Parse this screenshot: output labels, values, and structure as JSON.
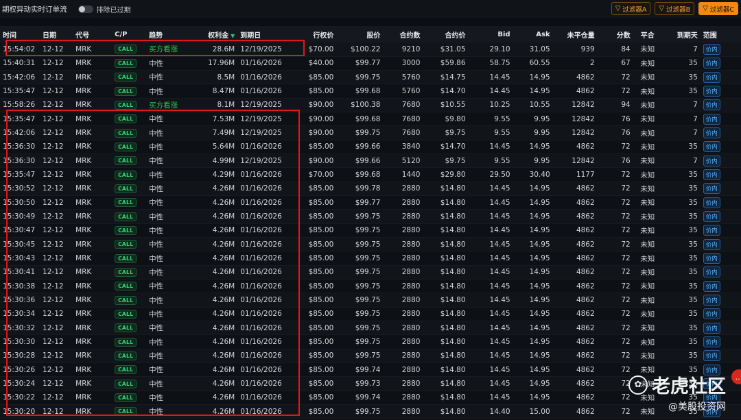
{
  "topbar": {
    "title": "期权异动实时订单流",
    "toggle_label": "排除已过期",
    "filters": [
      "过滤器A",
      "过滤器B",
      "过滤器C"
    ]
  },
  "columns": [
    "时间",
    "日期",
    "代号",
    "C/P",
    "趋势",
    "权利金",
    "到期日",
    "行权价",
    "股价",
    "合约数",
    "合约价",
    "Bid",
    "Ask",
    "未平仓量",
    "分数",
    "平合",
    "到期天",
    "范围"
  ],
  "rows": [
    [
      "15:54:02",
      "12-12",
      "MRK",
      "CALL",
      "买方看涨",
      "28.6M",
      "12/19/2025",
      "$70.00",
      "$100.22",
      "9210",
      "$31.05",
      "29.10",
      "31.05",
      "939",
      "84",
      "未知",
      "7",
      "价内"
    ],
    [
      "15:40:31",
      "12-12",
      "MRK",
      "CALL",
      "中性",
      "17.96M",
      "01/16/2026",
      "$40.00",
      "$99.77",
      "3000",
      "$59.86",
      "58.75",
      "60.55",
      "2",
      "67",
      "未知",
      "35",
      "价内"
    ],
    [
      "15:42:06",
      "12-12",
      "MRK",
      "CALL",
      "中性",
      "8.5M",
      "01/16/2026",
      "$85.00",
      "$99.75",
      "5760",
      "$14.75",
      "14.45",
      "14.95",
      "4862",
      "72",
      "未知",
      "35",
      "价内"
    ],
    [
      "15:35:47",
      "12-12",
      "MRK",
      "CALL",
      "中性",
      "8.47M",
      "01/16/2026",
      "$85.00",
      "$99.68",
      "5760",
      "$14.70",
      "14.45",
      "14.95",
      "4862",
      "72",
      "未知",
      "35",
      "价内"
    ],
    [
      "15:58:26",
      "12-12",
      "MRK",
      "CALL",
      "买方看涨",
      "8.1M",
      "12/19/2025",
      "$90.00",
      "$100.38",
      "7680",
      "$10.55",
      "10.25",
      "10.55",
      "12842",
      "94",
      "未知",
      "7",
      "价内"
    ],
    [
      "15:35:47",
      "12-12",
      "MRK",
      "CALL",
      "中性",
      "7.53M",
      "12/19/2025",
      "$90.00",
      "$99.68",
      "7680",
      "$9.80",
      "9.55",
      "9.95",
      "12842",
      "76",
      "未知",
      "7",
      "价内"
    ],
    [
      "15:42:06",
      "12-12",
      "MRK",
      "CALL",
      "中性",
      "7.49M",
      "12/19/2025",
      "$90.00",
      "$99.75",
      "7680",
      "$9.75",
      "9.55",
      "9.95",
      "12842",
      "76",
      "未知",
      "7",
      "价内"
    ],
    [
      "15:36:30",
      "12-12",
      "MRK",
      "CALL",
      "中性",
      "5.64M",
      "01/16/2026",
      "$85.00",
      "$99.66",
      "3840",
      "$14.70",
      "14.45",
      "14.95",
      "4862",
      "72",
      "未知",
      "35",
      "价内"
    ],
    [
      "15:36:30",
      "12-12",
      "MRK",
      "CALL",
      "中性",
      "4.99M",
      "12/19/2025",
      "$90.00",
      "$99.66",
      "5120",
      "$9.75",
      "9.55",
      "9.95",
      "12842",
      "76",
      "未知",
      "7",
      "价内"
    ],
    [
      "15:35:47",
      "12-12",
      "MRK",
      "CALL",
      "中性",
      "4.29M",
      "01/16/2026",
      "$70.00",
      "$99.68",
      "1440",
      "$29.80",
      "29.50",
      "30.40",
      "1177",
      "72",
      "未知",
      "35",
      "价内"
    ],
    [
      "15:30:52",
      "12-12",
      "MRK",
      "CALL",
      "中性",
      "4.26M",
      "01/16/2026",
      "$85.00",
      "$99.78",
      "2880",
      "$14.80",
      "14.45",
      "14.95",
      "4862",
      "72",
      "未知",
      "35",
      "价内"
    ],
    [
      "15:30:50",
      "12-12",
      "MRK",
      "CALL",
      "中性",
      "4.26M",
      "01/16/2026",
      "$85.00",
      "$99.77",
      "2880",
      "$14.80",
      "14.45",
      "14.95",
      "4862",
      "72",
      "未知",
      "35",
      "价内"
    ],
    [
      "15:30:49",
      "12-12",
      "MRK",
      "CALL",
      "中性",
      "4.26M",
      "01/16/2026",
      "$85.00",
      "$99.75",
      "2880",
      "$14.80",
      "14.45",
      "14.95",
      "4862",
      "72",
      "未知",
      "35",
      "价内"
    ],
    [
      "15:30:47",
      "12-12",
      "MRK",
      "CALL",
      "中性",
      "4.26M",
      "01/16/2026",
      "$85.00",
      "$99.75",
      "2880",
      "$14.80",
      "14.45",
      "14.95",
      "4862",
      "72",
      "未知",
      "35",
      "价内"
    ],
    [
      "15:30:45",
      "12-12",
      "MRK",
      "CALL",
      "中性",
      "4.26M",
      "01/16/2026",
      "$85.00",
      "$99.75",
      "2880",
      "$14.80",
      "14.45",
      "14.95",
      "4862",
      "72",
      "未知",
      "35",
      "价内"
    ],
    [
      "15:30:43",
      "12-12",
      "MRK",
      "CALL",
      "中性",
      "4.26M",
      "01/16/2026",
      "$85.00",
      "$99.75",
      "2880",
      "$14.80",
      "14.45",
      "14.95",
      "4862",
      "72",
      "未知",
      "35",
      "价内"
    ],
    [
      "15:30:41",
      "12-12",
      "MRK",
      "CALL",
      "中性",
      "4.26M",
      "01/16/2026",
      "$85.00",
      "$99.75",
      "2880",
      "$14.80",
      "14.45",
      "14.95",
      "4862",
      "72",
      "未知",
      "35",
      "价内"
    ],
    [
      "15:30:38",
      "12-12",
      "MRK",
      "CALL",
      "中性",
      "4.26M",
      "01/16/2026",
      "$85.00",
      "$99.75",
      "2880",
      "$14.80",
      "14.45",
      "14.95",
      "4862",
      "72",
      "未知",
      "35",
      "价内"
    ],
    [
      "15:30:36",
      "12-12",
      "MRK",
      "CALL",
      "中性",
      "4.26M",
      "01/16/2026",
      "$85.00",
      "$99.75",
      "2880",
      "$14.80",
      "14.45",
      "14.95",
      "4862",
      "72",
      "未知",
      "35",
      "价内"
    ],
    [
      "15:30:34",
      "12-12",
      "MRK",
      "CALL",
      "中性",
      "4.26M",
      "01/16/2026",
      "$85.00",
      "$99.75",
      "2880",
      "$14.80",
      "14.45",
      "14.95",
      "4862",
      "72",
      "未知",
      "35",
      "价内"
    ],
    [
      "15:30:32",
      "12-12",
      "MRK",
      "CALL",
      "中性",
      "4.26M",
      "01/16/2026",
      "$85.00",
      "$99.75",
      "2880",
      "$14.80",
      "14.45",
      "14.95",
      "4862",
      "72",
      "未知",
      "35",
      "价内"
    ],
    [
      "15:30:30",
      "12-12",
      "MRK",
      "CALL",
      "中性",
      "4.26M",
      "01/16/2026",
      "$85.00",
      "$99.75",
      "2880",
      "$14.80",
      "14.45",
      "14.95",
      "4862",
      "72",
      "未知",
      "35",
      "价内"
    ],
    [
      "15:30:28",
      "12-12",
      "MRK",
      "CALL",
      "中性",
      "4.26M",
      "01/16/2026",
      "$85.00",
      "$99.75",
      "2880",
      "$14.80",
      "14.45",
      "14.95",
      "4862",
      "72",
      "未知",
      "35",
      "价内"
    ],
    [
      "15:30:26",
      "12-12",
      "MRK",
      "CALL",
      "中性",
      "4.26M",
      "01/16/2026",
      "$85.00",
      "$99.74",
      "2880",
      "$14.80",
      "14.45",
      "14.95",
      "4862",
      "72",
      "未知",
      "35",
      "价内"
    ],
    [
      "15:30:24",
      "12-12",
      "MRK",
      "CALL",
      "中性",
      "4.26M",
      "01/16/2026",
      "$85.00",
      "$99.73",
      "2880",
      "$14.80",
      "14.45",
      "14.95",
      "4862",
      "72",
      "未知",
      "35",
      "价内"
    ],
    [
      "15:30:22",
      "12-12",
      "MRK",
      "CALL",
      "中性",
      "4.26M",
      "01/16/2026",
      "$85.00",
      "$99.74",
      "2880",
      "$14.80",
      "14.45",
      "14.95",
      "4862",
      "72",
      "未知",
      "35",
      "价内"
    ],
    [
      "15:30:20",
      "12-12",
      "MRK",
      "CALL",
      "中性",
      "4.26M",
      "01/16/2026",
      "$85.00",
      "$99.75",
      "2880",
      "$14.80",
      "14.40",
      "15.00",
      "4862",
      "72",
      "未知",
      "35",
      "价内"
    ]
  ],
  "colors": {
    "bullish": "#2ecc4f",
    "call_badge": "#38d27a",
    "in_money_badge": "#5ab4ff",
    "filter_accent": "#f08a12",
    "highlight_box": "#e01818"
  },
  "watermark": {
    "main": "老虎社区",
    "sub": "@美股投资网"
  },
  "icons": {
    "filter": "filter-icon",
    "sort": "sort-desc-icon",
    "chat": "chat-icon"
  }
}
